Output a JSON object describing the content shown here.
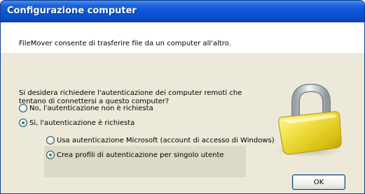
{
  "window": {
    "title": "Configurazione computer"
  },
  "description": "FileMover consente di trasferire file da un computer all'altro.",
  "question": {
    "line1": "Si desidera richiedere l'autenticazione dei computer remoti che",
    "line2": "tentano di connettersi a questo computer?"
  },
  "auth_options": [
    {
      "label": "No, l'autenticazione non è richiesta",
      "selected": false
    },
    {
      "label": "Sì, l'autenticazione è richiesta",
      "selected": true
    }
  ],
  "auth_methods": [
    {
      "label": "Usa autenticazione Microsoft (account di accesso di Windows)",
      "selected": false
    },
    {
      "label": "Crea profili di autenticazione per singolo utente",
      "selected": true
    }
  ],
  "ok_button": "OK",
  "icons": {
    "padlock": "padlock-icon"
  },
  "colors": {
    "titlebar": "#0a55d8",
    "dialog_bg": "#ece9d8",
    "radio_dot": "#21a121",
    "lock_gold": "#e8d62a"
  }
}
